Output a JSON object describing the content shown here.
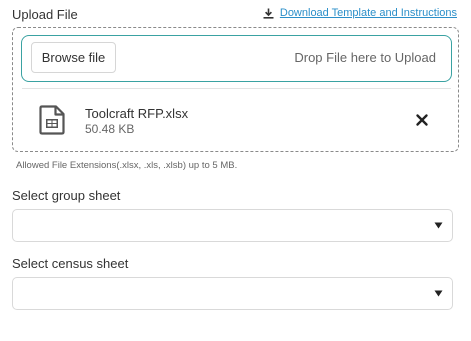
{
  "upload": {
    "label": "Upload File",
    "download_link": "Download Template and Instructions",
    "browse_button": "Browse file",
    "drop_text": "Drop File here to Upload",
    "file": {
      "name": "Toolcraft RFP.xlsx",
      "size": "50.48 KB",
      "icon": "spreadsheet-file-icon"
    },
    "allowed_text": "Allowed File Extensions(.xlsx, .xls, .xlsb) up to 5 MB."
  },
  "group_sheet": {
    "label": "Select group sheet",
    "value": ""
  },
  "census_sheet": {
    "label": "Select census sheet",
    "value": ""
  },
  "colors": {
    "accent_border": "#3aa2a2",
    "link": "#2b8fc9"
  }
}
